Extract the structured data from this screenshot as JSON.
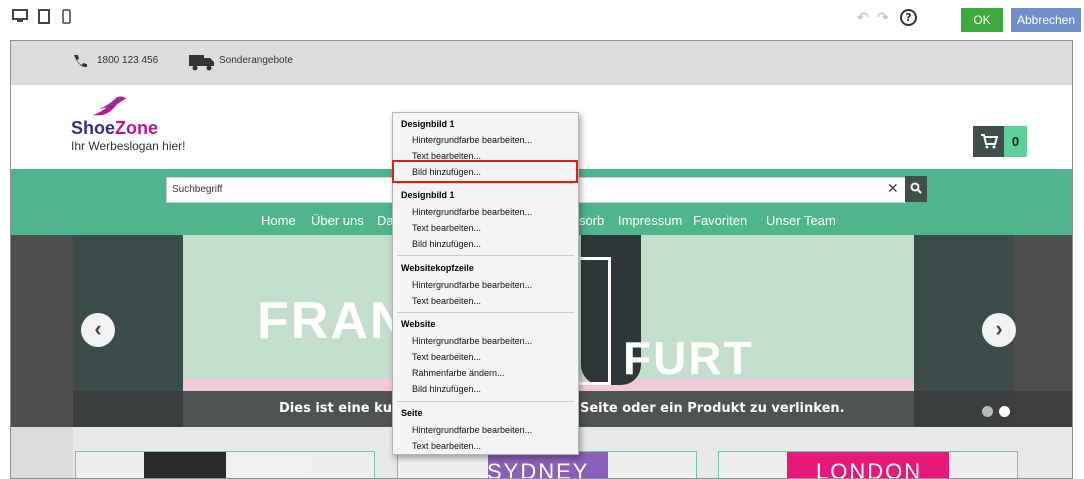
{
  "toolbar": {
    "device_icons": [
      "desktop-icon",
      "tablet-icon",
      "mobile-icon"
    ],
    "undo_icon": "undo-icon",
    "redo_icon": "redo-icon",
    "help_label": "?",
    "ok_label": "OK",
    "cancel_label": "Abbrechen"
  },
  "site": {
    "topbar": {
      "phone": "1800 123 456",
      "offers": "Sonderangebote"
    },
    "logo": {
      "part1": "Shoe",
      "part2": "Zone",
      "slogan": "Ihr Werbeslogan hier!"
    },
    "cart_count": "0",
    "search_placeholder": "Suchbegriff",
    "nav": [
      "Home",
      "Über uns",
      "Da",
      "sorb",
      "Impressum",
      "Favoriten",
      "Unser Team"
    ],
    "hero": {
      "text_left": "FRAN",
      "text_right": "FURT",
      "caption_left": "Dies ist eine kurz",
      "caption_right": "Seite oder ein Produkt zu verlinken."
    },
    "cards": [
      "SYDNEY",
      "LONDON"
    ]
  },
  "context_menu": {
    "sections": [
      {
        "title": "Designbild 1",
        "items": [
          "Hintergrundfarbe bearbeiten...",
          "Text bearbeiten...",
          "Bild hinzufügen..."
        ]
      },
      {
        "title": "Designbild 1",
        "items": [
          "Hintergrundfarbe bearbeiten...",
          "Text bearbeiten...",
          "Bild hinzufügen..."
        ]
      },
      {
        "title": "Websitekopfzeile",
        "items": [
          "Hintergrundfarbe bearbeiten...",
          "Text bearbeiten..."
        ]
      },
      {
        "title": "Website",
        "items": [
          "Hintergrundfarbe bearbeiten...",
          "Text bearbeiten...",
          "Rahmenfarbe ändern...",
          "Bild hinzufügen..."
        ]
      },
      {
        "title": "Seite",
        "items": [
          "Hintergrundfarbe bearbeiten...",
          "Text bearbeiten..."
        ]
      }
    ]
  },
  "colors": {
    "green_bar": "#4fb58c",
    "ok_button": "#3eaa3e",
    "cancel_button": "#6e91c9",
    "highlight": "#e01e1e"
  }
}
